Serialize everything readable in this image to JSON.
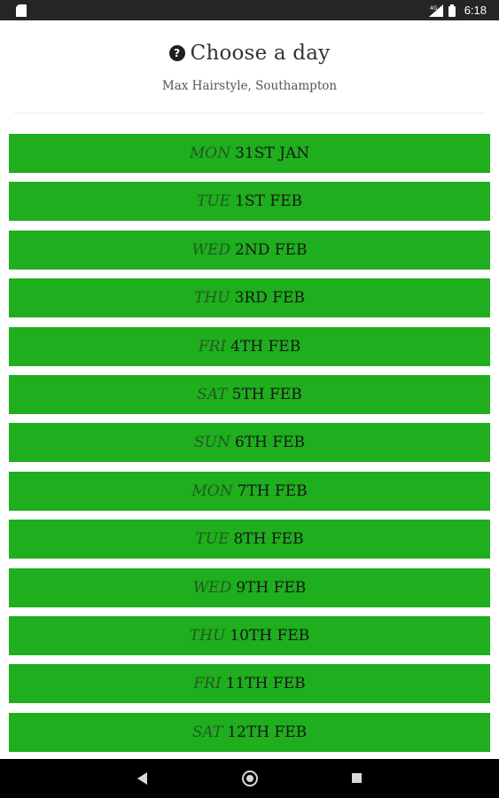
{
  "status_bar": {
    "time": "6:18",
    "icons": [
      "sd-card-icon",
      "signal-icon",
      "battery-icon"
    ]
  },
  "header": {
    "title": "Choose a day",
    "subtitle": "Max Hairstyle, Southampton",
    "help_icon_glyph": "?"
  },
  "days": [
    {
      "day": "MON",
      "date": "31ST JAN"
    },
    {
      "day": "TUE",
      "date": "1ST FEB"
    },
    {
      "day": "WED",
      "date": "2ND FEB"
    },
    {
      "day": "THU",
      "date": "3RD FEB"
    },
    {
      "day": "FRI",
      "date": "4TH FEB"
    },
    {
      "day": "SAT",
      "date": "5TH FEB"
    },
    {
      "day": "SUN",
      "date": "6TH FEB"
    },
    {
      "day": "MON",
      "date": "7TH FEB"
    },
    {
      "day": "TUE",
      "date": "8TH FEB"
    },
    {
      "day": "WED",
      "date": "9TH FEB"
    },
    {
      "day": "THU",
      "date": "10TH FEB"
    },
    {
      "day": "FRI",
      "date": "11TH FEB"
    },
    {
      "day": "SAT",
      "date": "12TH FEB"
    }
  ],
  "colors": {
    "button_green": "#1eae1e",
    "status_bar": "#252525",
    "nav_bar": "#000000"
  },
  "nav_bar": {
    "icons": [
      "back-icon",
      "home-icon",
      "recent-apps-icon"
    ]
  }
}
